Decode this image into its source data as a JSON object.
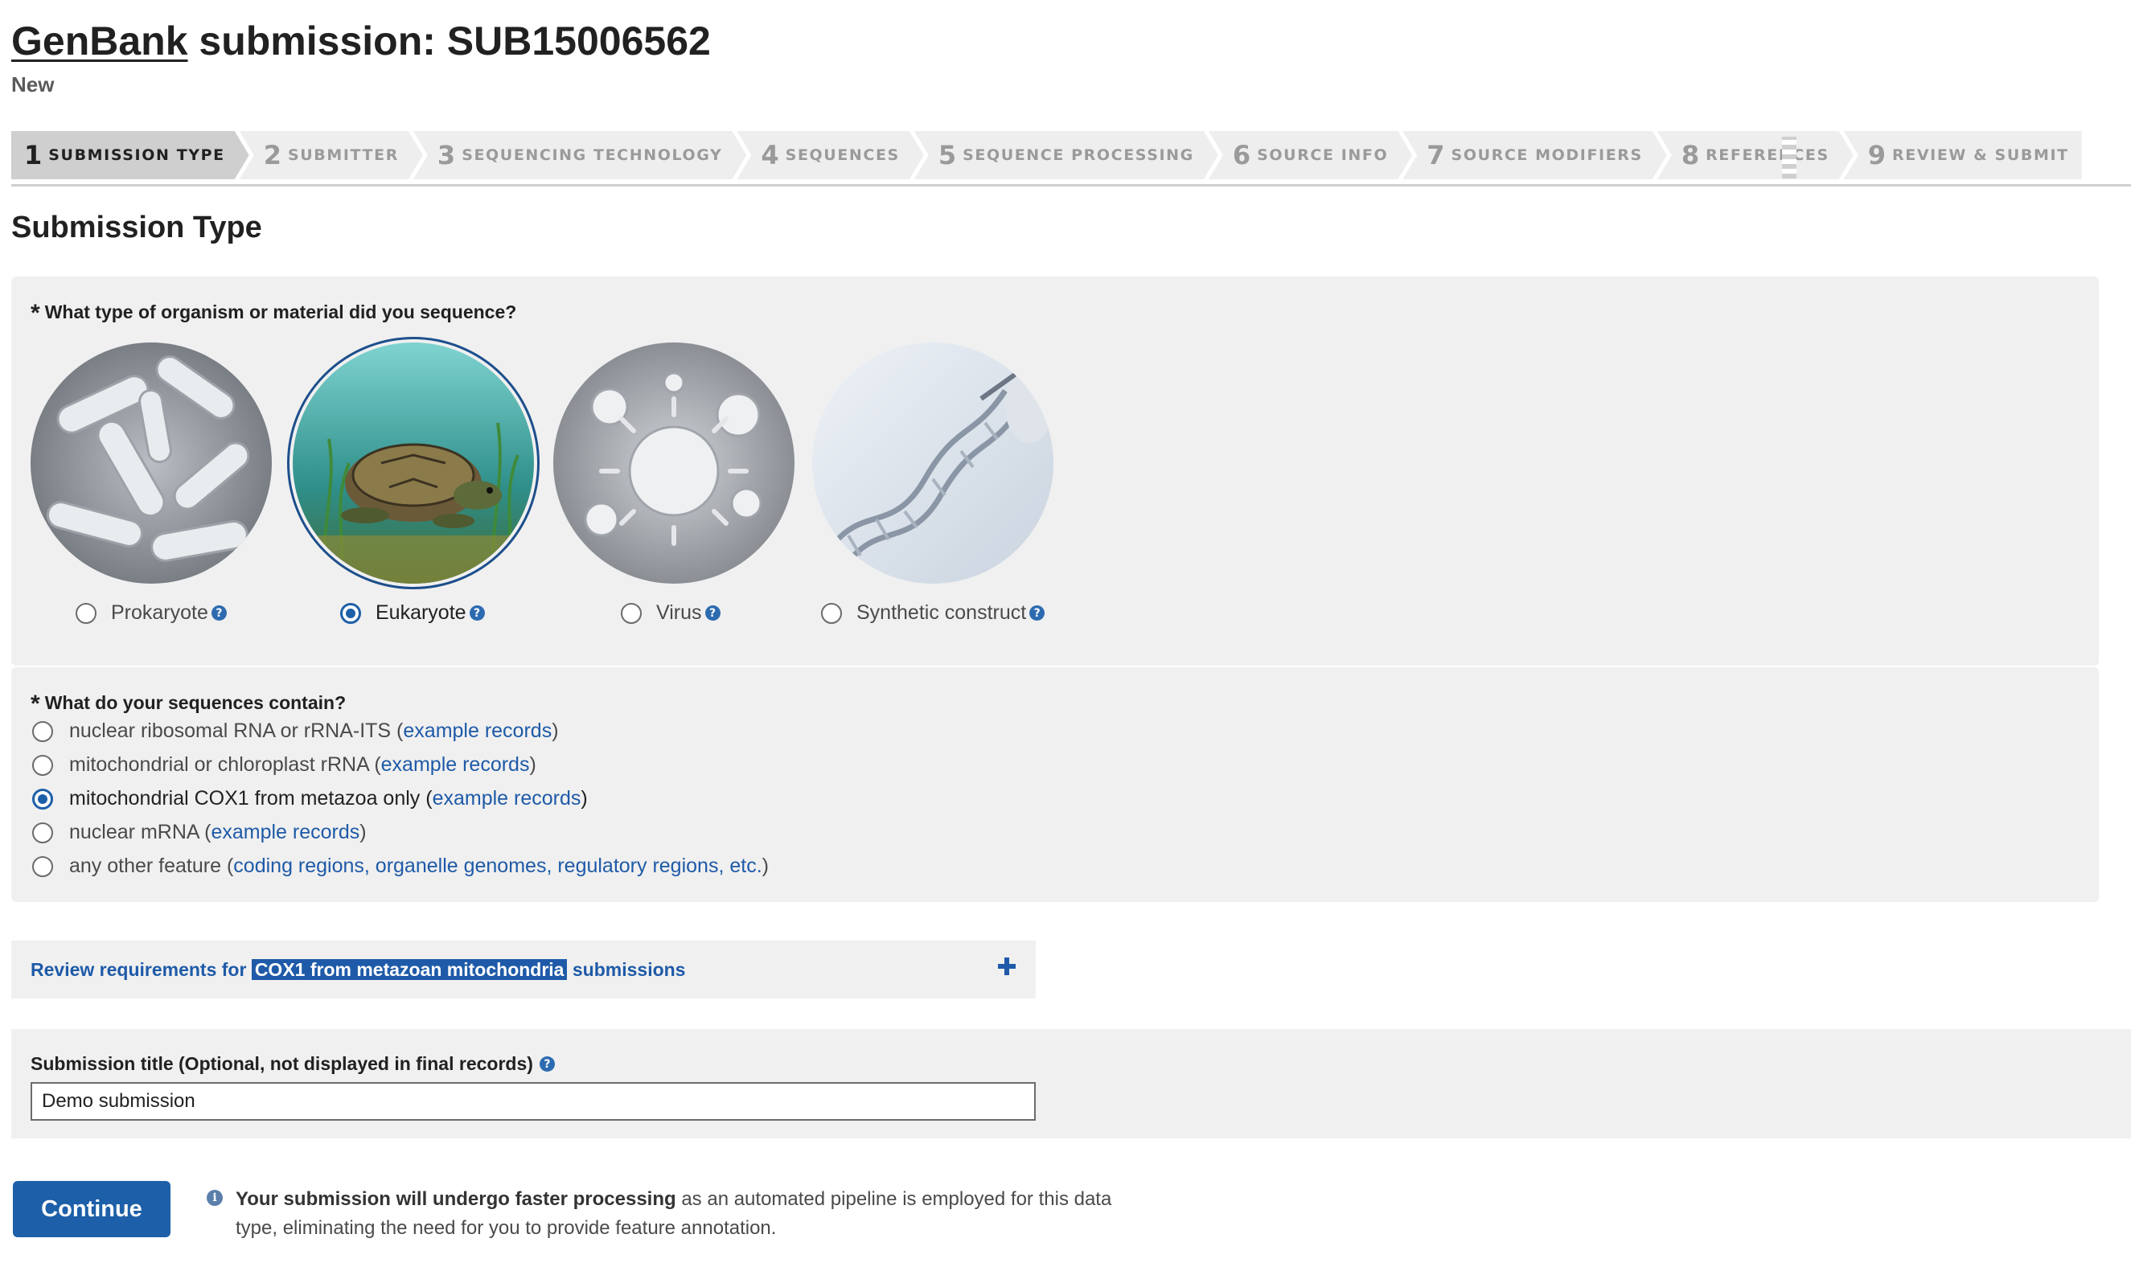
{
  "header": {
    "title_link": "GenBank",
    "title_rest": " submission: SUB15006562",
    "status": "New"
  },
  "steps": [
    {
      "num": "1",
      "label": "SUBMISSION TYPE",
      "active": true
    },
    {
      "num": "2",
      "label": "SUBMITTER"
    },
    {
      "num": "3",
      "label": "SEQUENCING TECHNOLOGY"
    },
    {
      "num": "4",
      "label": "SEQUENCES"
    },
    {
      "num": "5",
      "label": "SEQUENCE PROCESSING"
    },
    {
      "num": "6",
      "label": "SOURCE INFO"
    },
    {
      "num": "7",
      "label": "SOURCE MODIFIERS"
    },
    {
      "num": "8",
      "label": "REFERENCES"
    },
    {
      "num": "9",
      "label": "REVIEW & SUBMIT"
    }
  ],
  "section_title": "Submission Type",
  "organism_question": {
    "required_mark": "*",
    "label": "What type of organism or material did you sequence?",
    "options": [
      {
        "label": "Prokaryote",
        "icon": "bacteria-image",
        "selected": false
      },
      {
        "label": "Eukaryote",
        "icon": "turtle-image",
        "selected": true
      },
      {
        "label": "Virus",
        "icon": "virus-image",
        "selected": false
      },
      {
        "label": "Synthetic construct",
        "icon": "dna-image",
        "selected": false
      }
    ]
  },
  "contents_question": {
    "required_mark": "*",
    "label": "What do your sequences contain?",
    "options": [
      {
        "text": "nuclear ribosomal RNA or rRNA-ITS (",
        "link": "example records",
        "suffix": ")",
        "selected": false
      },
      {
        "text": "mitochondrial or chloroplast rRNA (",
        "link": "example records",
        "suffix": ")",
        "selected": false
      },
      {
        "text": "mitochondrial COX1 from metazoa only (",
        "link": "example records",
        "suffix": ")",
        "selected": true
      },
      {
        "text": "nuclear mRNA (",
        "link": "example records",
        "suffix": ")",
        "selected": false
      },
      {
        "text": "any other feature (",
        "link": "coding regions, organelle genomes, regulatory regions, etc.",
        "suffix": ")",
        "selected": false
      }
    ]
  },
  "review": {
    "prefix": "Review requirements for ",
    "highlight": "COX1 from metazoan mitochondria",
    "suffix": " submissions",
    "icon": "plus-icon"
  },
  "submission_title": {
    "label": "Submission title (Optional, not displayed in final records)",
    "value": "Demo submission"
  },
  "continue_label": "Continue",
  "info": {
    "bold": "Your submission will undergo faster processing",
    "rest": " as an automated pipeline is employed for this data type, eliminating the need for you to provide feature annotation."
  },
  "colors": {
    "accent": "#1d5fa8",
    "link": "#1e5aa8",
    "panel": "#f0f0f0",
    "step_active": "#cfcfcf",
    "step_inactive": "#eeeeee"
  }
}
